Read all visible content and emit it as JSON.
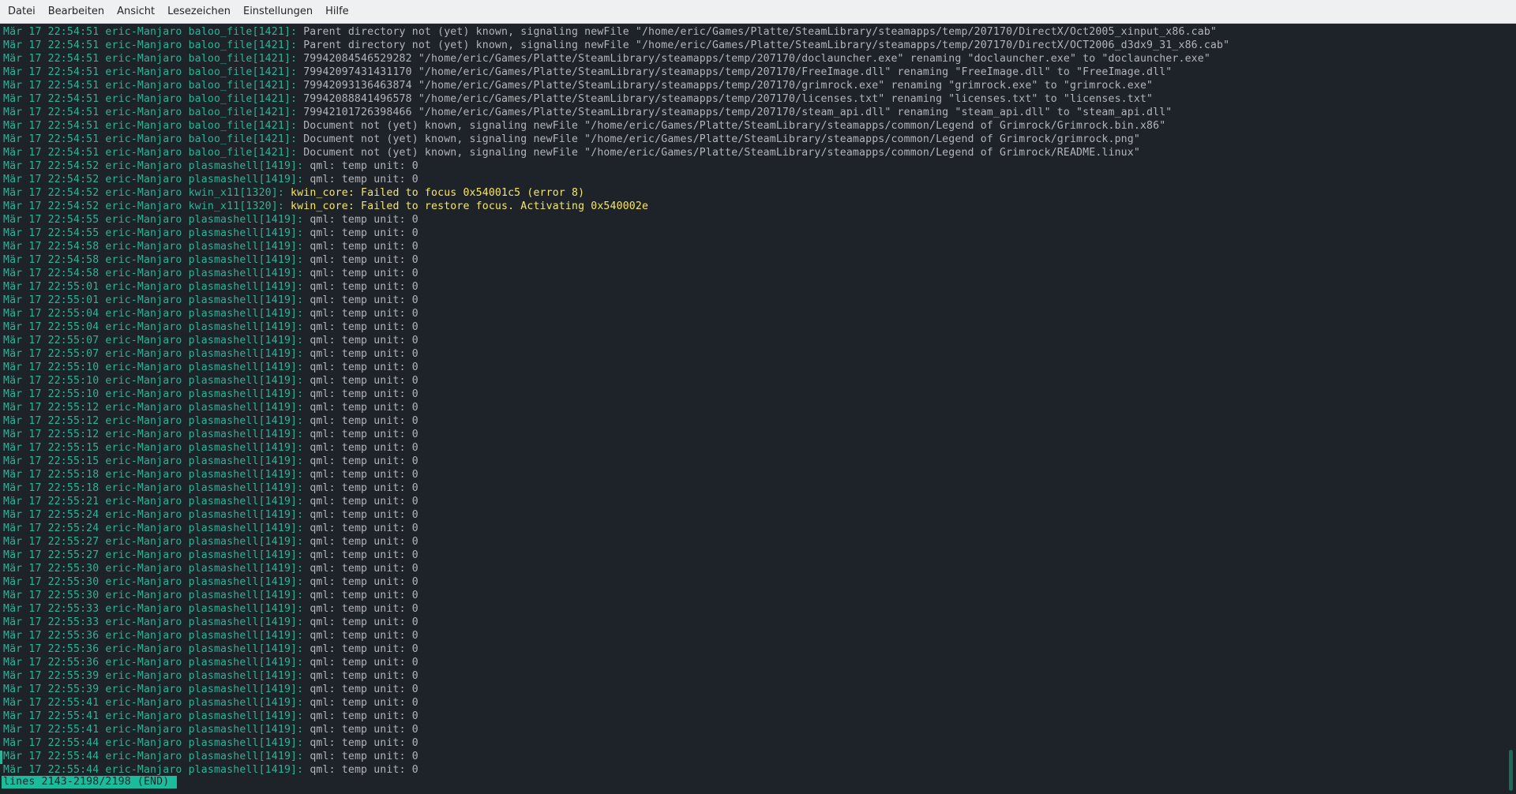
{
  "menu": [
    "Datei",
    "Bearbeiten",
    "Ansicht",
    "Lesezeichen",
    "Einstellungen",
    "Hilfe"
  ],
  "log_lines": [
    {
      "meta": "Mär 17 22:54:51 eric-Manjaro baloo_file[1421]:",
      "msg": "Parent directory not (yet) known, signaling newFile \"/home/eric/Games/Platte/SteamLibrary/steamapps/temp/207170/DirectX/Oct2005_xinput_x86.cab\"",
      "level": "normal"
    },
    {
      "meta": "Mär 17 22:54:51 eric-Manjaro baloo_file[1421]:",
      "msg": "Parent directory not (yet) known, signaling newFile \"/home/eric/Games/Platte/SteamLibrary/steamapps/temp/207170/DirectX/OCT2006_d3dx9_31_x86.cab\"",
      "level": "normal"
    },
    {
      "meta": "Mär 17 22:54:51 eric-Manjaro baloo_file[1421]:",
      "msg": "79942084546529282 \"/home/eric/Games/Platte/SteamLibrary/steamapps/temp/207170/doclauncher.exe\" renaming \"doclauncher.exe\" to \"doclauncher.exe\"",
      "level": "normal"
    },
    {
      "meta": "Mär 17 22:54:51 eric-Manjaro baloo_file[1421]:",
      "msg": "79942097431431170 \"/home/eric/Games/Platte/SteamLibrary/steamapps/temp/207170/FreeImage.dll\" renaming \"FreeImage.dll\" to \"FreeImage.dll\"",
      "level": "normal"
    },
    {
      "meta": "Mär 17 22:54:51 eric-Manjaro baloo_file[1421]:",
      "msg": "79942093136463874 \"/home/eric/Games/Platte/SteamLibrary/steamapps/temp/207170/grimrock.exe\" renaming \"grimrock.exe\" to \"grimrock.exe\"",
      "level": "normal"
    },
    {
      "meta": "Mär 17 22:54:51 eric-Manjaro baloo_file[1421]:",
      "msg": "79942088841496578 \"/home/eric/Games/Platte/SteamLibrary/steamapps/temp/207170/licenses.txt\" renaming \"licenses.txt\" to \"licenses.txt\"",
      "level": "normal"
    },
    {
      "meta": "Mär 17 22:54:51 eric-Manjaro baloo_file[1421]:",
      "msg": "79942101726398466 \"/home/eric/Games/Platte/SteamLibrary/steamapps/temp/207170/steam_api.dll\" renaming \"steam_api.dll\" to \"steam_api.dll\"",
      "level": "normal"
    },
    {
      "meta": "Mär 17 22:54:51 eric-Manjaro baloo_file[1421]:",
      "msg": "Document not (yet) known, signaling newFile \"/home/eric/Games/Platte/SteamLibrary/steamapps/common/Legend of Grimrock/Grimrock.bin.x86\"",
      "level": "normal"
    },
    {
      "meta": "Mär 17 22:54:51 eric-Manjaro baloo_file[1421]:",
      "msg": "Document not (yet) known, signaling newFile \"/home/eric/Games/Platte/SteamLibrary/steamapps/common/Legend of Grimrock/grimrock.png\"",
      "level": "normal"
    },
    {
      "meta": "Mär 17 22:54:51 eric-Manjaro baloo_file[1421]:",
      "msg": "Document not (yet) known, signaling newFile \"/home/eric/Games/Platte/SteamLibrary/steamapps/common/Legend of Grimrock/README.linux\"",
      "level": "normal"
    },
    {
      "meta": "Mär 17 22:54:52 eric-Manjaro plasmashell[1419]:",
      "msg": "qml: temp unit: 0",
      "level": "normal"
    },
    {
      "meta": "Mär 17 22:54:52 eric-Manjaro plasmashell[1419]:",
      "msg": "qml: temp unit: 0",
      "level": "normal"
    },
    {
      "meta": "Mär 17 22:54:52 eric-Manjaro kwin_x11[1320]:",
      "msg": "kwin_core: Failed to focus 0x54001c5 (error 8)",
      "level": "warn"
    },
    {
      "meta": "Mär 17 22:54:52 eric-Manjaro kwin_x11[1320]:",
      "msg": "kwin_core: Failed to restore focus. Activating 0x540002e",
      "level": "warn"
    },
    {
      "meta": "Mär 17 22:54:55 eric-Manjaro plasmashell[1419]:",
      "msg": "qml: temp unit: 0",
      "level": "normal"
    },
    {
      "meta": "Mär 17 22:54:55 eric-Manjaro plasmashell[1419]:",
      "msg": "qml: temp unit: 0",
      "level": "normal"
    },
    {
      "meta": "Mär 17 22:54:58 eric-Manjaro plasmashell[1419]:",
      "msg": "qml: temp unit: 0",
      "level": "normal"
    },
    {
      "meta": "Mär 17 22:54:58 eric-Manjaro plasmashell[1419]:",
      "msg": "qml: temp unit: 0",
      "level": "normal"
    },
    {
      "meta": "Mär 17 22:54:58 eric-Manjaro plasmashell[1419]:",
      "msg": "qml: temp unit: 0",
      "level": "normal"
    },
    {
      "meta": "Mär 17 22:55:01 eric-Manjaro plasmashell[1419]:",
      "msg": "qml: temp unit: 0",
      "level": "normal"
    },
    {
      "meta": "Mär 17 22:55:01 eric-Manjaro plasmashell[1419]:",
      "msg": "qml: temp unit: 0",
      "level": "normal"
    },
    {
      "meta": "Mär 17 22:55:04 eric-Manjaro plasmashell[1419]:",
      "msg": "qml: temp unit: 0",
      "level": "normal"
    },
    {
      "meta": "Mär 17 22:55:04 eric-Manjaro plasmashell[1419]:",
      "msg": "qml: temp unit: 0",
      "level": "normal"
    },
    {
      "meta": "Mär 17 22:55:07 eric-Manjaro plasmashell[1419]:",
      "msg": "qml: temp unit: 0",
      "level": "normal"
    },
    {
      "meta": "Mär 17 22:55:07 eric-Manjaro plasmashell[1419]:",
      "msg": "qml: temp unit: 0",
      "level": "normal"
    },
    {
      "meta": "Mär 17 22:55:10 eric-Manjaro plasmashell[1419]:",
      "msg": "qml: temp unit: 0",
      "level": "normal"
    },
    {
      "meta": "Mär 17 22:55:10 eric-Manjaro plasmashell[1419]:",
      "msg": "qml: temp unit: 0",
      "level": "normal"
    },
    {
      "meta": "Mär 17 22:55:10 eric-Manjaro plasmashell[1419]:",
      "msg": "qml: temp unit: 0",
      "level": "normal"
    },
    {
      "meta": "Mär 17 22:55:12 eric-Manjaro plasmashell[1419]:",
      "msg": "qml: temp unit: 0",
      "level": "normal"
    },
    {
      "meta": "Mär 17 22:55:12 eric-Manjaro plasmashell[1419]:",
      "msg": "qml: temp unit: 0",
      "level": "normal"
    },
    {
      "meta": "Mär 17 22:55:12 eric-Manjaro plasmashell[1419]:",
      "msg": "qml: temp unit: 0",
      "level": "normal"
    },
    {
      "meta": "Mär 17 22:55:15 eric-Manjaro plasmashell[1419]:",
      "msg": "qml: temp unit: 0",
      "level": "normal"
    },
    {
      "meta": "Mär 17 22:55:15 eric-Manjaro plasmashell[1419]:",
      "msg": "qml: temp unit: 0",
      "level": "normal"
    },
    {
      "meta": "Mär 17 22:55:18 eric-Manjaro plasmashell[1419]:",
      "msg": "qml: temp unit: 0",
      "level": "normal"
    },
    {
      "meta": "Mär 17 22:55:18 eric-Manjaro plasmashell[1419]:",
      "msg": "qml: temp unit: 0",
      "level": "normal"
    },
    {
      "meta": "Mär 17 22:55:21 eric-Manjaro plasmashell[1419]:",
      "msg": "qml: temp unit: 0",
      "level": "normal"
    },
    {
      "meta": "Mär 17 22:55:24 eric-Manjaro plasmashell[1419]:",
      "msg": "qml: temp unit: 0",
      "level": "normal"
    },
    {
      "meta": "Mär 17 22:55:24 eric-Manjaro plasmashell[1419]:",
      "msg": "qml: temp unit: 0",
      "level": "normal"
    },
    {
      "meta": "Mär 17 22:55:27 eric-Manjaro plasmashell[1419]:",
      "msg": "qml: temp unit: 0",
      "level": "normal"
    },
    {
      "meta": "Mär 17 22:55:27 eric-Manjaro plasmashell[1419]:",
      "msg": "qml: temp unit: 0",
      "level": "normal"
    },
    {
      "meta": "Mär 17 22:55:30 eric-Manjaro plasmashell[1419]:",
      "msg": "qml: temp unit: 0",
      "level": "normal"
    },
    {
      "meta": "Mär 17 22:55:30 eric-Manjaro plasmashell[1419]:",
      "msg": "qml: temp unit: 0",
      "level": "normal"
    },
    {
      "meta": "Mär 17 22:55:30 eric-Manjaro plasmashell[1419]:",
      "msg": "qml: temp unit: 0",
      "level": "normal"
    },
    {
      "meta": "Mär 17 22:55:33 eric-Manjaro plasmashell[1419]:",
      "msg": "qml: temp unit: 0",
      "level": "normal"
    },
    {
      "meta": "Mär 17 22:55:33 eric-Manjaro plasmashell[1419]:",
      "msg": "qml: temp unit: 0",
      "level": "normal"
    },
    {
      "meta": "Mär 17 22:55:36 eric-Manjaro plasmashell[1419]:",
      "msg": "qml: temp unit: 0",
      "level": "normal"
    },
    {
      "meta": "Mär 17 22:55:36 eric-Manjaro plasmashell[1419]:",
      "msg": "qml: temp unit: 0",
      "level": "normal"
    },
    {
      "meta": "Mär 17 22:55:36 eric-Manjaro plasmashell[1419]:",
      "msg": "qml: temp unit: 0",
      "level": "normal"
    },
    {
      "meta": "Mär 17 22:55:39 eric-Manjaro plasmashell[1419]:",
      "msg": "qml: temp unit: 0",
      "level": "normal"
    },
    {
      "meta": "Mär 17 22:55:39 eric-Manjaro plasmashell[1419]:",
      "msg": "qml: temp unit: 0",
      "level": "normal"
    },
    {
      "meta": "Mär 17 22:55:41 eric-Manjaro plasmashell[1419]:",
      "msg": "qml: temp unit: 0",
      "level": "normal"
    },
    {
      "meta": "Mär 17 22:55:41 eric-Manjaro plasmashell[1419]:",
      "msg": "qml: temp unit: 0",
      "level": "normal"
    },
    {
      "meta": "Mär 17 22:55:41 eric-Manjaro plasmashell[1419]:",
      "msg": "qml: temp unit: 0",
      "level": "normal"
    },
    {
      "meta": "Mär 17 22:55:44 eric-Manjaro plasmashell[1419]:",
      "msg": "qml: temp unit: 0",
      "level": "normal"
    },
    {
      "meta": "Mär 17 22:55:44 eric-Manjaro plasmashell[1419]:",
      "msg": "qml: temp unit: 0",
      "level": "normal"
    },
    {
      "meta": "Mär 17 22:55:44 eric-Manjaro plasmashell[1419]:",
      "msg": "qml: temp unit: 0",
      "level": "normal"
    }
  ],
  "status_line": "lines 2143-2198/2198 (END)",
  "colors": {
    "background": "#1e2229",
    "meta_text": "#2fb397",
    "message_text": "#b3b6b9",
    "warning_text": "#f5e66a",
    "status_background": "#1abc9c"
  }
}
